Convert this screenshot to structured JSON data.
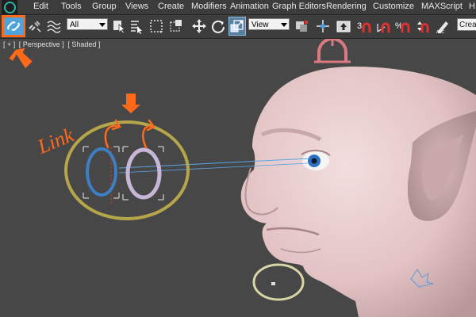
{
  "menubar": {
    "items": [
      "Edit",
      "Tools",
      "Group",
      "Views",
      "Create",
      "Modifiers",
      "Animation",
      "Graph Editors",
      "Rendering",
      "Customize",
      "MAXScript",
      "H"
    ]
  },
  "toolbar": {
    "selection_filter": "All",
    "reference_coordinate": "View",
    "named_selection": "Crea",
    "icons": [
      "select-and-link-icon",
      "unlink-icon",
      "bind-space-warp-icon",
      "select-object-icon",
      "select-by-name-icon",
      "rectangular-selection-icon",
      "window-crossing-icon",
      "select-and-move-icon",
      "select-and-rotate-icon",
      "select-and-scale-icon",
      "use-pivot-center-icon",
      "select-and-manipulate-icon",
      "keyboard-shortcut-override-icon",
      "snaps-toggle-icon",
      "angle-snap-icon",
      "percent-snap-icon",
      "spinner-snap-icon",
      "edit-named-selections-icon"
    ],
    "accent": "#ff6a1a"
  },
  "viewport": {
    "label_plus": "[ + ]",
    "label_view": "[ Perspective ]",
    "label_shading": "[ Shaded ]",
    "background": "#474747"
  },
  "annotation": {
    "text": "Link",
    "color": "#ff6a1a"
  }
}
